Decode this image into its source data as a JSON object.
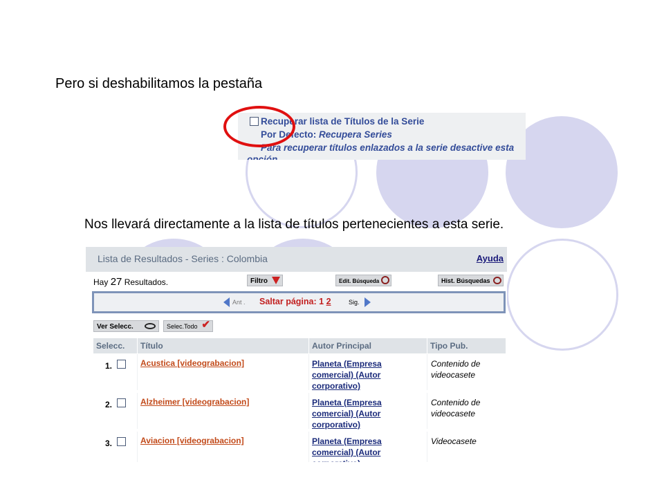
{
  "slide": {
    "heading1": "Pero si deshabilitamos la pestaña",
    "heading2": "Nos llevará directamente a la lista de títulos pertenecientes a esta serie."
  },
  "option_panel": {
    "line1": "Recuperar lista de Títulos de la Serie",
    "line2_label": "Por Defecto:",
    "line2_value": "Recupera Series",
    "line3": "Para recuperar títulos enlazados a la serie desactive esta",
    "line4": "opción",
    "highlight_color": "#e01010"
  },
  "results": {
    "title": "Lista de Resultados - Series : Colombia",
    "help": "Ayuda",
    "hay": "Hay",
    "count": "27",
    "resultados": "Resultados.",
    "filter_button": "Filtro",
    "edit_search_button": "Edit. Búsqueda",
    "history_button": "Hist. Búsquedas",
    "pager": {
      "prev": "Ant .",
      "jump_label": "Saltar página: 1",
      "page2": "2",
      "next": "Sig."
    },
    "view_selected_button": "Ver Selecc.",
    "select_all_button": "Selec.Todo",
    "columns": [
      "Selecc.",
      "Título",
      "Autor Principal",
      "Tipo Pub."
    ],
    "rows": [
      {
        "num": "1.",
        "title": "Acustica [videograbacion]",
        "author": "Planeta (Empresa comercial) (Autor corporativo)",
        "tipo": "Contenido de videocasete"
      },
      {
        "num": "2.",
        "title": "Alzheimer [videograbacion]",
        "author": "Planeta (Empresa comercial) (Autor corporativo)",
        "tipo": "Contenido de videocasete"
      },
      {
        "num": "3.",
        "title": "Aviacion [videograbacion]",
        "author": "Planeta (Empresa comercial) (Autor corporativo)",
        "tipo": "Videocasete"
      }
    ]
  }
}
